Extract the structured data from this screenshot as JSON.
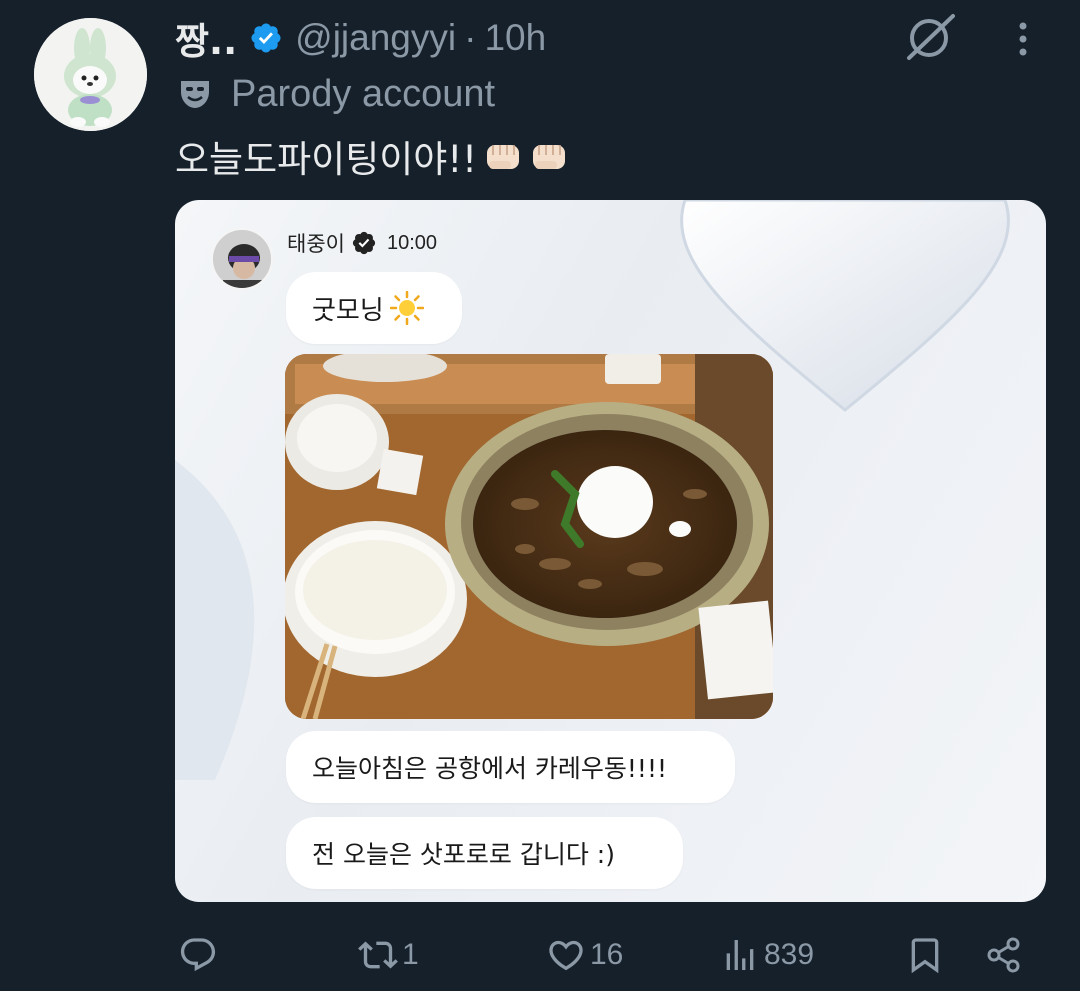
{
  "author": {
    "display_name": "짱..",
    "handle": "@jjangyyi",
    "separator": "·",
    "time": "10h",
    "label": "Parody account"
  },
  "tweet": {
    "text": "오늘도파이팅이야!!"
  },
  "media": {
    "author_name": "태중이",
    "time": "10:00",
    "bubble_1": "굿모닝",
    "bubble_2": "오늘아침은 공항에서 카레우동!!!!",
    "bubble_3": "전 오늘은 삿포로로 갑니다 :)"
  },
  "actions": {
    "replies": "",
    "reposts": "1",
    "likes": "16",
    "views": "839"
  },
  "colors": {
    "background": "#15202b",
    "text_primary": "#e7e9ea",
    "text_secondary": "#8b98a5",
    "verified": "#1d9bf0"
  },
  "icons": [
    "verified-badge-icon",
    "grok-icon",
    "more-icon",
    "parody-mask-icon",
    "reply-icon",
    "repost-icon",
    "like-icon",
    "views-icon",
    "bookmark-icon",
    "share-icon"
  ]
}
